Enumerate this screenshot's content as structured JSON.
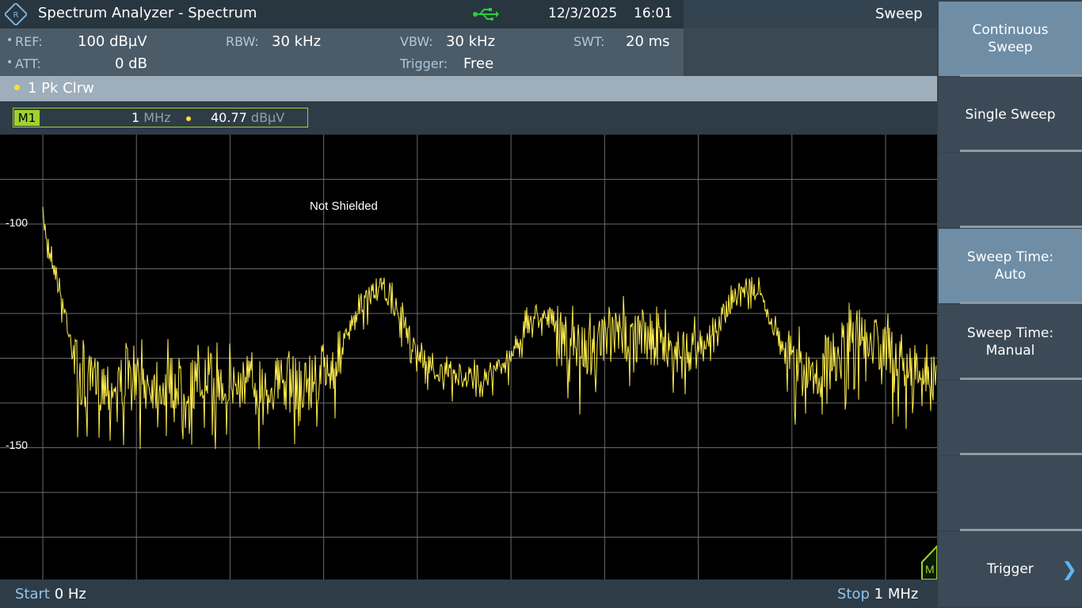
{
  "header": {
    "title": "Spectrum Analyzer - Spectrum",
    "date": "12/3/2025",
    "time": "16:01",
    "mode": "Sweep"
  },
  "settings": {
    "ref_label": "REF:",
    "ref_value": "100 dBµV",
    "att_label": "ATT:",
    "att_value": "0 dB",
    "rbw_label": "RBW:",
    "rbw_value": "30 kHz",
    "vbw_label": "VBW:",
    "vbw_value": "30 kHz",
    "trigger_label": "Trigger:",
    "trigger_value": "Free",
    "swt_label": "SWT:",
    "swt_value": "20 ms",
    "indicator": "•"
  },
  "trace": {
    "label": "1 Pk  Clrw"
  },
  "marker": {
    "tag": "M1",
    "freq_value": "1",
    "freq_unit": "MHz",
    "level_value": "40.77",
    "level_unit": "dBµV"
  },
  "plot": {
    "annotation": "Not Shielded",
    "y_labels": [
      "-100",
      "-150"
    ],
    "trace_color": "#ffee4d"
  },
  "footer": {
    "start_label": "Start",
    "start_value": "0 Hz",
    "stop_label": "Stop",
    "stop_value": "1 MHz"
  },
  "softkeys": [
    {
      "label": "Continuous\nSweep",
      "active": true
    },
    {
      "label": "Single Sweep",
      "active": false
    },
    {
      "label": "",
      "active": false
    },
    {
      "label": "Sweep Time:\nAuto",
      "active": true
    },
    {
      "label": "Sweep Time:\nManual",
      "active": false
    },
    {
      "label": "",
      "active": false
    },
    {
      "label": "",
      "active": false
    },
    {
      "label": "Trigger",
      "active": false
    }
  ],
  "colors": {
    "trace": "#ffee4d",
    "marker": "#9fd132",
    "accent": "#5fb4f3"
  }
}
